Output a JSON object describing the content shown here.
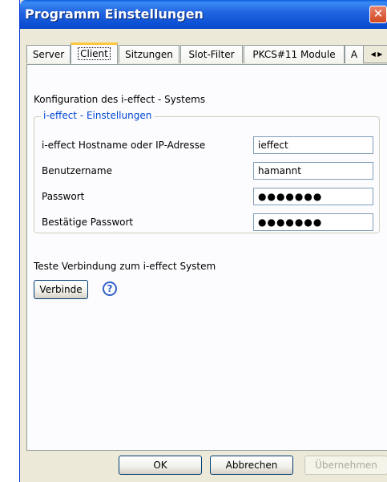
{
  "window": {
    "title": "Programm Einstellungen",
    "close_symbol": "✕",
    "titlebar_color": "#0a5ddc"
  },
  "tabs": [
    {
      "label": "Server"
    },
    {
      "label": "Client",
      "active": true
    },
    {
      "label": "Sitzungen"
    },
    {
      "label": "Slot-Filter"
    },
    {
      "label": "PKCS#11 Module"
    },
    {
      "label": "A"
    }
  ],
  "tab_scroll": {
    "left": "◀",
    "right": "▶"
  },
  "panel": {
    "heading": "Konfiguration des i-effect - Systems",
    "group_title": "i-effect - Einstellungen",
    "fields": [
      {
        "label": "i-effect Hostname oder IP-Adresse",
        "value": "ieffect"
      },
      {
        "label": "Benutzername",
        "value": "hamannt"
      },
      {
        "label": "Passwort",
        "value": "●●●●●●●"
      },
      {
        "label": "Bestätige Passwort",
        "value": "●●●●●●●"
      }
    ],
    "test_label": "Teste Verbindung zum i-effect System",
    "connect_button": "Verbinde",
    "help_icon": "?"
  },
  "footer": {
    "ok": "OK",
    "cancel": "Abbrechen",
    "apply": "Übernehmen"
  },
  "colors": {
    "group_title": "#0046d5",
    "help_icon": "#3160c8"
  }
}
